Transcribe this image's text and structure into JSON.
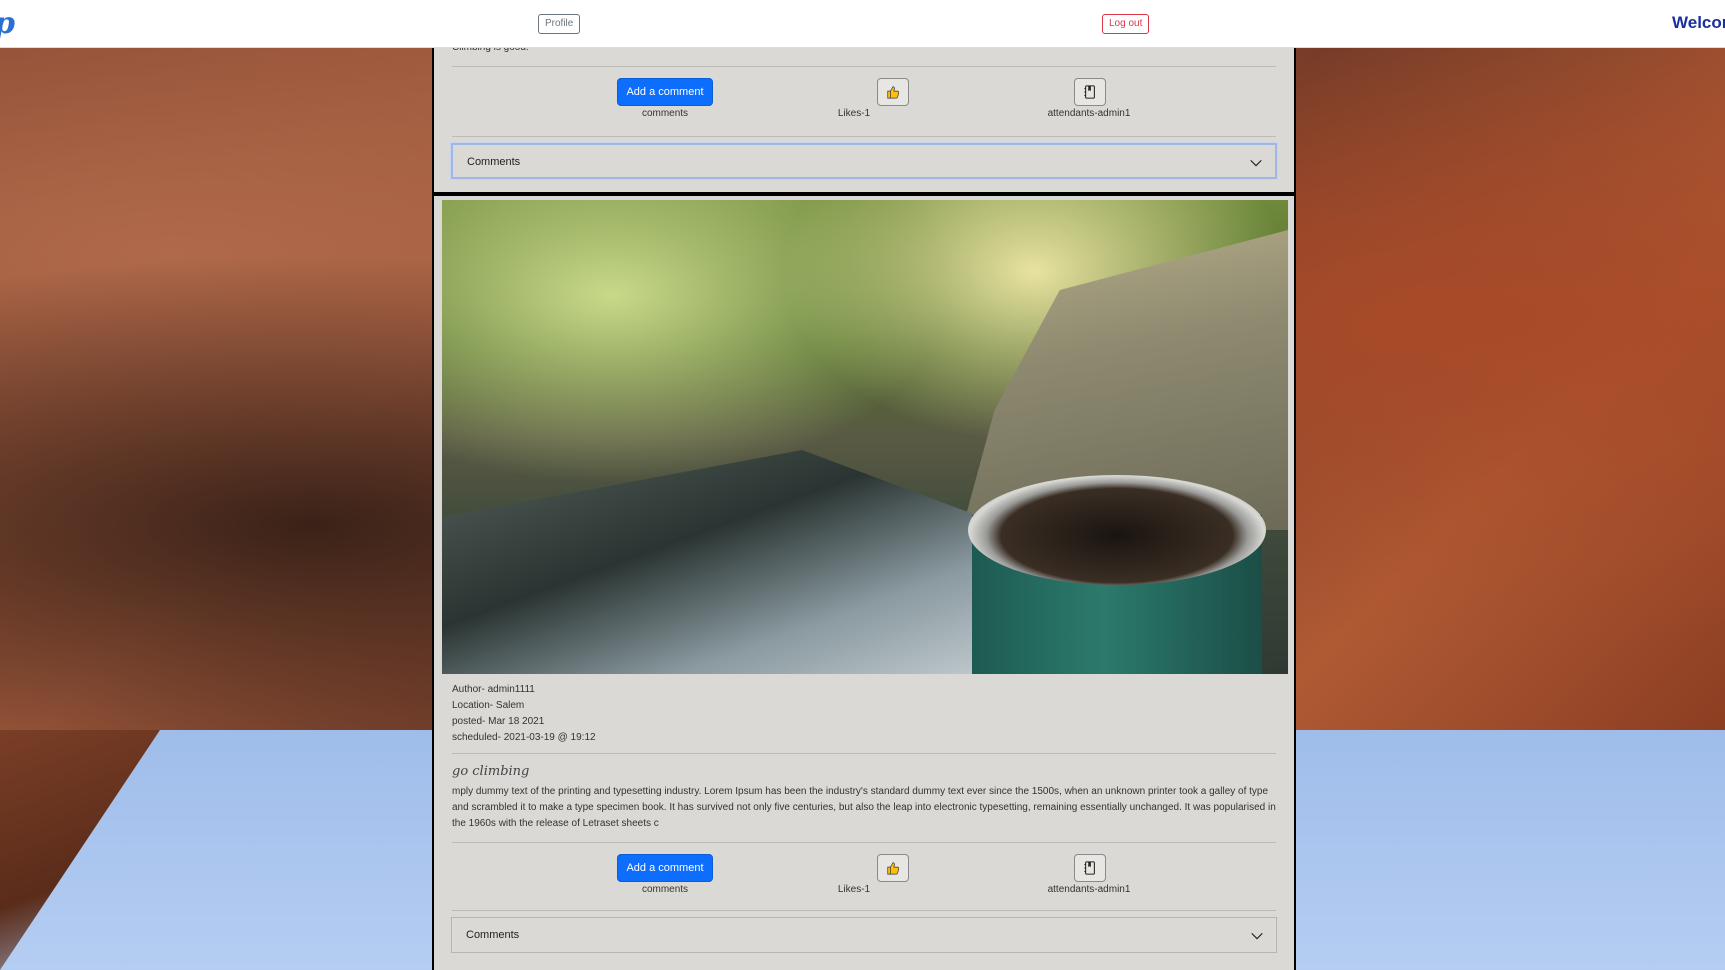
{
  "navbar": {
    "brand": "p",
    "profile_label": "Profile",
    "logout_label": "Log out",
    "welcome": "Welcome"
  },
  "posts": [
    {
      "description_fragment": "Climbing is good.",
      "add_comment_label": "Add a comment",
      "comments_label": "comments",
      "likes_label": "Likes-1",
      "attendants_label": "attendants-admin1",
      "accordion_label": "Comments"
    },
    {
      "author": "Author- admin1111",
      "location": "Location- Salem",
      "posted": "posted- Mar 18 2021",
      "scheduled": "scheduled- 2021-03-19 @ 19:12",
      "title": "go climbing",
      "description": "mply dummy text of the printing and typesetting industry. Lorem Ipsum has been the industry's standard dummy text ever since the 1500s, when an unknown printer took a galley of type and scrambled it to make a type specimen book. It has survived not only five centuries, but also the leap into electronic typesetting, remaining essentially unchanged. It was popularised in the 1960s with the release of Letraset sheets c",
      "add_comment_label": "Add a comment",
      "comments_label": "comments",
      "likes_label": "Likes-1",
      "attendants_label": "attendants-admin1",
      "accordion_label": "Comments"
    }
  ],
  "colors": {
    "primary": "#0d6efd",
    "danger": "#dc3545",
    "secondary": "#6c757d",
    "card_bg": "#dbd9d5",
    "welcome": "#1a2fa0"
  },
  "icons": {
    "like": "thumbs-up-icon",
    "attend": "journal-bookmark-icon",
    "accordion": "chevron-down-icon"
  }
}
